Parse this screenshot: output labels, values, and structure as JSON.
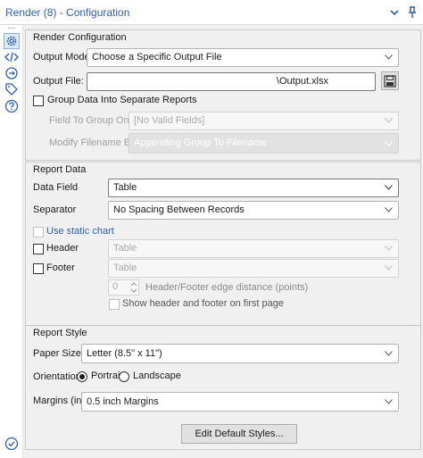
{
  "window": {
    "title": "Render (8) - Configuration"
  },
  "rail": {
    "icons": [
      "gear-icon",
      "code-icon",
      "connection-icon",
      "tag-icon",
      "help-icon",
      "check-circle-icon"
    ]
  },
  "render_config": {
    "heading": "Render Configuration",
    "output_mode_label": "Output Mode:",
    "output_mode_value": "Choose a Specific Output File",
    "output_file_label": "Output File:",
    "output_file_value": "\\Output.xlsx",
    "group_label": "Group Data Into Separate Reports",
    "group_checked": false,
    "field_group_label": "Field To Group On:",
    "field_group_value": "[No Valid Fields]",
    "modify_label": "Modify Filename By:",
    "modify_value": "Appending Group To Filename"
  },
  "report_data": {
    "heading": "Report Data",
    "data_field_label": "Data Field",
    "data_field_value": "Table",
    "separator_label": "Separator",
    "separator_value": "No Spacing Between Records",
    "static_chart_label": "Use static chart",
    "header_label": "Header",
    "header_value": "Table",
    "footer_label": "Footer",
    "footer_value": "Table",
    "edge_value": "0",
    "edge_label": "Header/Footer edge distance (points)",
    "show_first_label": "Show header and footer on first page"
  },
  "report_style": {
    "heading": "Report Style",
    "paper_label": "Paper Size",
    "paper_value": "Letter (8.5\" x 11\")",
    "orientation_label": "Orientation",
    "orientation_options": [
      "Portrait",
      "Landscape"
    ],
    "orientation_selected": "Portrait",
    "margins_label": "Margins (in.)",
    "margins_value": "0.5 inch Margins",
    "edit_styles_label": "Edit Default Styles..."
  },
  "colors": {
    "title": "#2f5fa8",
    "panel": "#f0f0f0",
    "accent_selected": "#dce8f7"
  }
}
